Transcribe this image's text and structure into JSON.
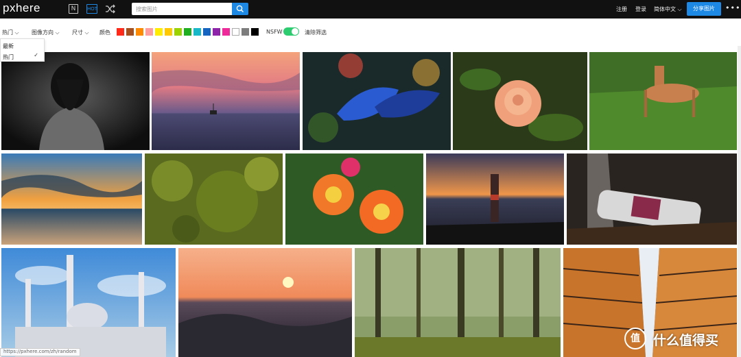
{
  "header": {
    "logo": "pxhere",
    "new_icon": "N",
    "hot_icon": "HOT",
    "search_placeholder": "搜索图片",
    "register": "注册",
    "login": "登录",
    "language": "简体中文 ⌵",
    "share": "分享图片",
    "more": "•••"
  },
  "filters": {
    "sort": "热门 ⌵",
    "orientation": "图像方向 ⌵",
    "size": "尺寸 ⌵",
    "color": "颜色",
    "nsfw": "NSFW",
    "clear": "清除筛选",
    "swatches": [
      "#ff2a1a",
      "#a5501e",
      "#ff8a00",
      "#ff9e9e",
      "#ffec00",
      "#ffc800",
      "#9bd200",
      "#1fae1f",
      "#18b8c8",
      "#1565c0",
      "#8e24aa",
      "#ee2a9a",
      "#ffffff",
      "#7d7d7d",
      "#000000"
    ]
  },
  "sort_menu": {
    "items": [
      "最新",
      "热门"
    ],
    "selected_mark": "✓"
  },
  "status_url": "https://pxhere.com/zh/random",
  "watermark": {
    "badge": "值",
    "text": "什么值得买"
  },
  "photos": [
    "woman-back-bw",
    "sunset-sea-sailboat",
    "blue-leaf-droplets",
    "peach-rose",
    "deer-in-grass",
    "sunset-beach-clouds",
    "green-bush",
    "orange-lily",
    "lighthouse-sunset",
    "smirnoff-bottle",
    "mosque-blue-sky",
    "ocean-wave-sunset",
    "misty-forest",
    "skyscrapers-looking-up"
  ]
}
